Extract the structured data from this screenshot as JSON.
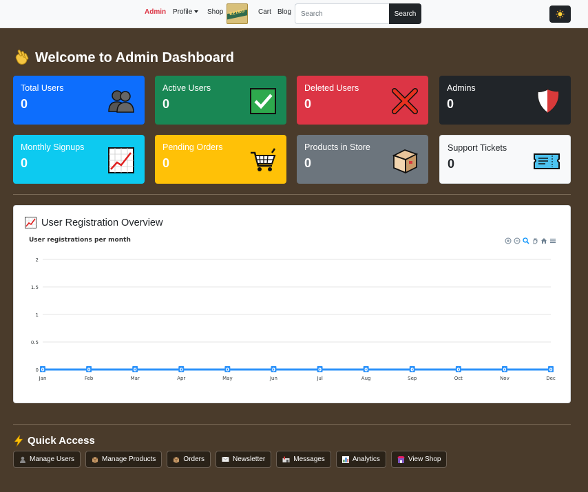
{
  "nav": {
    "admin": "Admin",
    "profile": "Profile",
    "shop": "Shop",
    "logo_text": "RETRO",
    "cart": "Cart",
    "blog": "Blog",
    "search_placeholder": "Search",
    "search_button": "Search"
  },
  "page": {
    "title": "Welcome to Admin Dashboard"
  },
  "cards": [
    {
      "label": "Total Users",
      "value": "0",
      "color": "#0d6efd",
      "icon": "users-icon"
    },
    {
      "label": "Active Users",
      "value": "0",
      "color": "#198754",
      "icon": "check-icon"
    },
    {
      "label": "Deleted Users",
      "value": "0",
      "color": "#dc3545",
      "icon": "cross-icon"
    },
    {
      "label": "Admins",
      "value": "0",
      "color": "#212529",
      "icon": "shield-icon"
    },
    {
      "label": "Monthly Signups",
      "value": "0",
      "color": "#0dcaf0",
      "icon": "chart-up-icon"
    },
    {
      "label": "Pending Orders",
      "value": "0",
      "color": "#ffc107",
      "icon": "cart-icon"
    },
    {
      "label": "Products in Store",
      "value": "0",
      "color": "#6c757d",
      "icon": "package-icon"
    },
    {
      "label": "Support Tickets",
      "value": "0",
      "color": "#f8f9fa",
      "icon": "ticket-icon"
    }
  ],
  "panel": {
    "title": "User Registration Overview",
    "subtitle": "User registrations per month"
  },
  "chart_data": {
    "type": "line",
    "title": "User registrations per month",
    "categories": [
      "Jan",
      "Feb",
      "Mar",
      "Apr",
      "May",
      "Jun",
      "Jul",
      "Aug",
      "Sep",
      "Oct",
      "Nov",
      "Dec"
    ],
    "values": [
      0,
      0,
      0,
      0,
      0,
      0,
      0,
      0,
      0,
      0,
      0,
      0
    ],
    "yticks": [
      "0",
      "0.5",
      "1",
      "1.5",
      "2"
    ],
    "ylim": [
      0,
      2
    ],
    "grid": true,
    "color": "#2e93fa"
  },
  "quick_access": {
    "title": "Quick Access",
    "buttons": [
      {
        "label": "Manage Users",
        "icon": "user-icon"
      },
      {
        "label": "Manage Products",
        "icon": "package-icon"
      },
      {
        "label": "Orders",
        "icon": "package-icon"
      },
      {
        "label": "Newsletter",
        "icon": "mail-icon"
      },
      {
        "label": "Messages",
        "icon": "mailbox-icon"
      },
      {
        "label": "Analytics",
        "icon": "bar-chart-icon"
      },
      {
        "label": "View Shop",
        "icon": "shop-icon"
      }
    ]
  }
}
